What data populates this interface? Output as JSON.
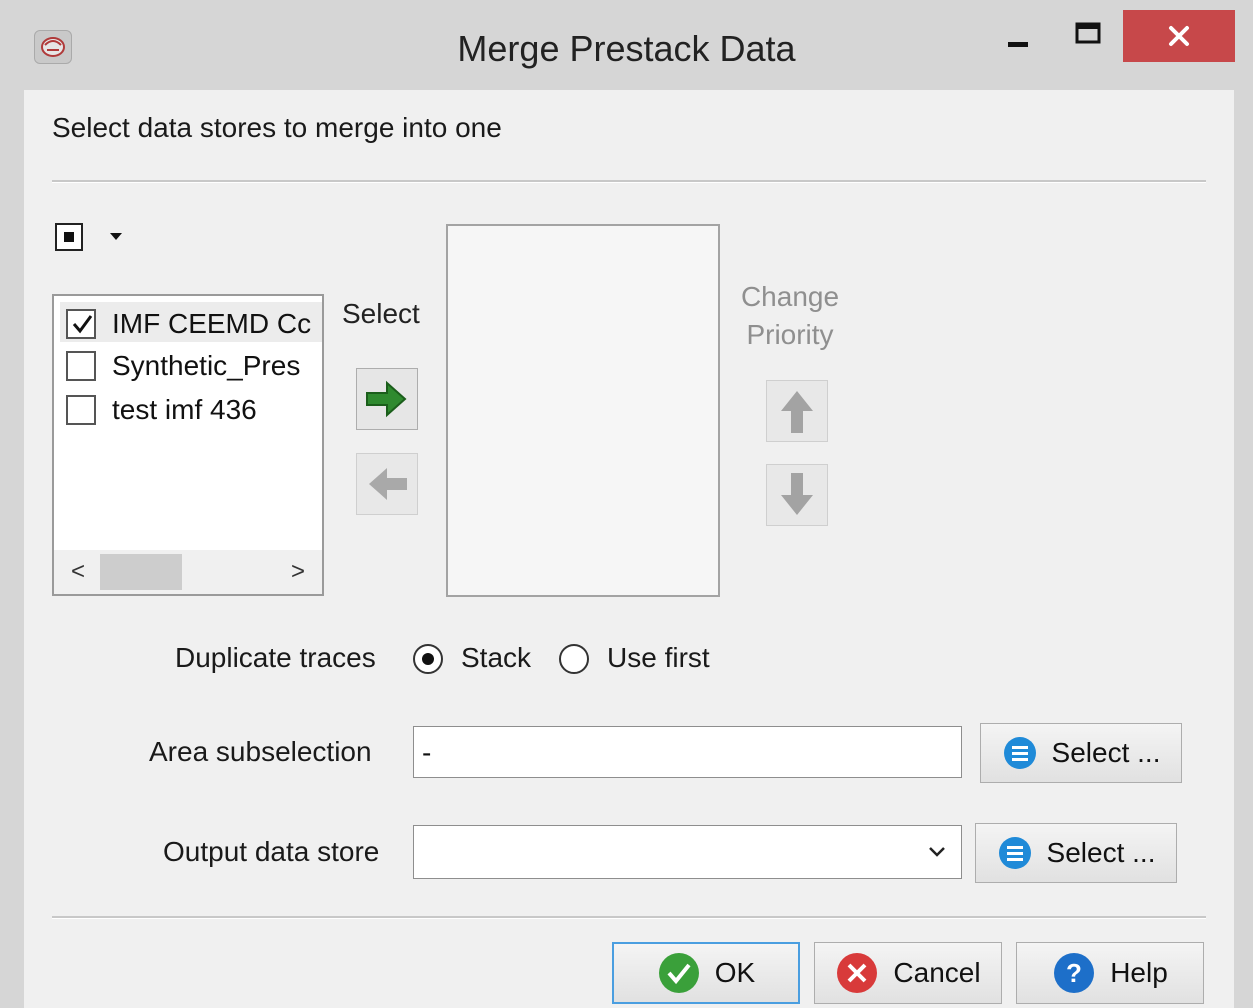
{
  "window": {
    "title": "Merge Prestack Data"
  },
  "header": {
    "text": "Select data stores to merge into one"
  },
  "available_list": {
    "items": [
      {
        "label": "IMF CEEMD Cc",
        "checked": true
      },
      {
        "label": "Synthetic_Pres",
        "checked": false
      },
      {
        "label": "test imf 436",
        "checked": false
      }
    ],
    "scroll_left": "<",
    "scroll_right": ">"
  },
  "transfer": {
    "label": "Select"
  },
  "priority": {
    "label_line1": "Change",
    "label_line2": "Priority"
  },
  "duplicate": {
    "label": "Duplicate traces",
    "options": [
      {
        "label": "Stack",
        "selected": true
      },
      {
        "label": "Use first",
        "selected": false
      }
    ]
  },
  "area": {
    "label": "Area subselection",
    "value": "-",
    "button": "Select ..."
  },
  "output": {
    "label": "Output data store",
    "value": "",
    "button": "Select ..."
  },
  "footer": {
    "ok": "OK",
    "cancel": "Cancel",
    "help": "Help"
  },
  "colors": {
    "close": "#c7484a",
    "accent": "#4a9ee0",
    "ok_green": "#3aa03a",
    "cancel_red": "#d83a3a",
    "help_blue": "#1d6fc9"
  }
}
